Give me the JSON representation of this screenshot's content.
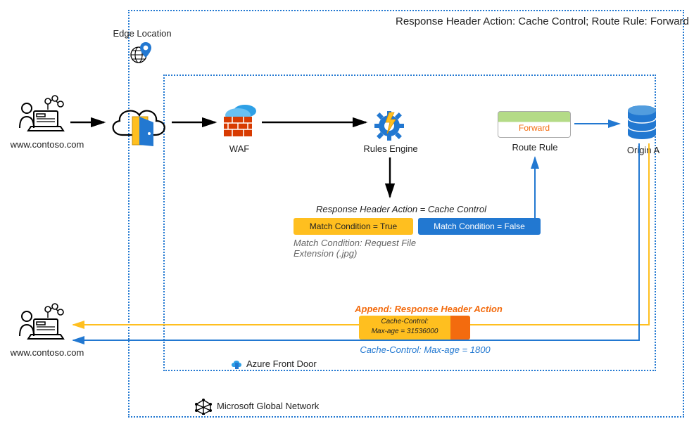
{
  "title": "Response Header Action: Cache Control; Route Rule: Forward",
  "edgeLocation": "Edge Location",
  "client": {
    "domain": "www.contoso.com"
  },
  "nodes": {
    "waf": "WAF",
    "rulesEngine": "Rules Engine",
    "routeRule": "Route Rule",
    "routeRuleForward": "Forward",
    "originA": "Origin A"
  },
  "rules": {
    "headerActionLine": "Response Header Action = Cache Control",
    "matchTrue": "Match Condition = True",
    "matchFalse": "Match Condition = False",
    "matchNote": "Match Condition: Request File Extension (.jpg)"
  },
  "append": {
    "title": "Append: Response Header Action",
    "boxLine1": "Cache-Control:",
    "boxLine2": "Max-age = 31536000"
  },
  "blueReturn": "Cache-Control: Max-age = 1800",
  "innerLabel": "Azure Front Door",
  "outerLabel": "Microsoft Global Network"
}
